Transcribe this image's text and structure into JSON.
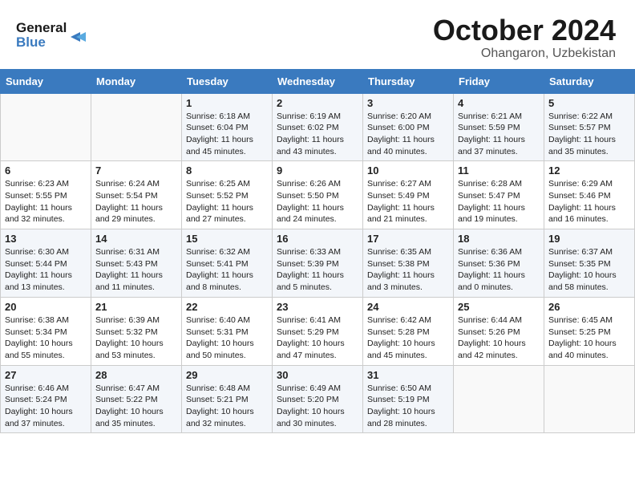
{
  "logo": {
    "line1": "General",
    "line2": "Blue"
  },
  "title": "October 2024",
  "location": "Ohangaron, Uzbekistan",
  "weekdays": [
    "Sunday",
    "Monday",
    "Tuesday",
    "Wednesday",
    "Thursday",
    "Friday",
    "Saturday"
  ],
  "weeks": [
    [
      {
        "day": "",
        "sunrise": "",
        "sunset": "",
        "daylight": ""
      },
      {
        "day": "",
        "sunrise": "",
        "sunset": "",
        "daylight": ""
      },
      {
        "day": "1",
        "sunrise": "Sunrise: 6:18 AM",
        "sunset": "Sunset: 6:04 PM",
        "daylight": "Daylight: 11 hours and 45 minutes."
      },
      {
        "day": "2",
        "sunrise": "Sunrise: 6:19 AM",
        "sunset": "Sunset: 6:02 PM",
        "daylight": "Daylight: 11 hours and 43 minutes."
      },
      {
        "day": "3",
        "sunrise": "Sunrise: 6:20 AM",
        "sunset": "Sunset: 6:00 PM",
        "daylight": "Daylight: 11 hours and 40 minutes."
      },
      {
        "day": "4",
        "sunrise": "Sunrise: 6:21 AM",
        "sunset": "Sunset: 5:59 PM",
        "daylight": "Daylight: 11 hours and 37 minutes."
      },
      {
        "day": "5",
        "sunrise": "Sunrise: 6:22 AM",
        "sunset": "Sunset: 5:57 PM",
        "daylight": "Daylight: 11 hours and 35 minutes."
      }
    ],
    [
      {
        "day": "6",
        "sunrise": "Sunrise: 6:23 AM",
        "sunset": "Sunset: 5:55 PM",
        "daylight": "Daylight: 11 hours and 32 minutes."
      },
      {
        "day": "7",
        "sunrise": "Sunrise: 6:24 AM",
        "sunset": "Sunset: 5:54 PM",
        "daylight": "Daylight: 11 hours and 29 minutes."
      },
      {
        "day": "8",
        "sunrise": "Sunrise: 6:25 AM",
        "sunset": "Sunset: 5:52 PM",
        "daylight": "Daylight: 11 hours and 27 minutes."
      },
      {
        "day": "9",
        "sunrise": "Sunrise: 6:26 AM",
        "sunset": "Sunset: 5:50 PM",
        "daylight": "Daylight: 11 hours and 24 minutes."
      },
      {
        "day": "10",
        "sunrise": "Sunrise: 6:27 AM",
        "sunset": "Sunset: 5:49 PM",
        "daylight": "Daylight: 11 hours and 21 minutes."
      },
      {
        "day": "11",
        "sunrise": "Sunrise: 6:28 AM",
        "sunset": "Sunset: 5:47 PM",
        "daylight": "Daylight: 11 hours and 19 minutes."
      },
      {
        "day": "12",
        "sunrise": "Sunrise: 6:29 AM",
        "sunset": "Sunset: 5:46 PM",
        "daylight": "Daylight: 11 hours and 16 minutes."
      }
    ],
    [
      {
        "day": "13",
        "sunrise": "Sunrise: 6:30 AM",
        "sunset": "Sunset: 5:44 PM",
        "daylight": "Daylight: 11 hours and 13 minutes."
      },
      {
        "day": "14",
        "sunrise": "Sunrise: 6:31 AM",
        "sunset": "Sunset: 5:43 PM",
        "daylight": "Daylight: 11 hours and 11 minutes."
      },
      {
        "day": "15",
        "sunrise": "Sunrise: 6:32 AM",
        "sunset": "Sunset: 5:41 PM",
        "daylight": "Daylight: 11 hours and 8 minutes."
      },
      {
        "day": "16",
        "sunrise": "Sunrise: 6:33 AM",
        "sunset": "Sunset: 5:39 PM",
        "daylight": "Daylight: 11 hours and 5 minutes."
      },
      {
        "day": "17",
        "sunrise": "Sunrise: 6:35 AM",
        "sunset": "Sunset: 5:38 PM",
        "daylight": "Daylight: 11 hours and 3 minutes."
      },
      {
        "day": "18",
        "sunrise": "Sunrise: 6:36 AM",
        "sunset": "Sunset: 5:36 PM",
        "daylight": "Daylight: 11 hours and 0 minutes."
      },
      {
        "day": "19",
        "sunrise": "Sunrise: 6:37 AM",
        "sunset": "Sunset: 5:35 PM",
        "daylight": "Daylight: 10 hours and 58 minutes."
      }
    ],
    [
      {
        "day": "20",
        "sunrise": "Sunrise: 6:38 AM",
        "sunset": "Sunset: 5:34 PM",
        "daylight": "Daylight: 10 hours and 55 minutes."
      },
      {
        "day": "21",
        "sunrise": "Sunrise: 6:39 AM",
        "sunset": "Sunset: 5:32 PM",
        "daylight": "Daylight: 10 hours and 53 minutes."
      },
      {
        "day": "22",
        "sunrise": "Sunrise: 6:40 AM",
        "sunset": "Sunset: 5:31 PM",
        "daylight": "Daylight: 10 hours and 50 minutes."
      },
      {
        "day": "23",
        "sunrise": "Sunrise: 6:41 AM",
        "sunset": "Sunset: 5:29 PM",
        "daylight": "Daylight: 10 hours and 47 minutes."
      },
      {
        "day": "24",
        "sunrise": "Sunrise: 6:42 AM",
        "sunset": "Sunset: 5:28 PM",
        "daylight": "Daylight: 10 hours and 45 minutes."
      },
      {
        "day": "25",
        "sunrise": "Sunrise: 6:44 AM",
        "sunset": "Sunset: 5:26 PM",
        "daylight": "Daylight: 10 hours and 42 minutes."
      },
      {
        "day": "26",
        "sunrise": "Sunrise: 6:45 AM",
        "sunset": "Sunset: 5:25 PM",
        "daylight": "Daylight: 10 hours and 40 minutes."
      }
    ],
    [
      {
        "day": "27",
        "sunrise": "Sunrise: 6:46 AM",
        "sunset": "Sunset: 5:24 PM",
        "daylight": "Daylight: 10 hours and 37 minutes."
      },
      {
        "day": "28",
        "sunrise": "Sunrise: 6:47 AM",
        "sunset": "Sunset: 5:22 PM",
        "daylight": "Daylight: 10 hours and 35 minutes."
      },
      {
        "day": "29",
        "sunrise": "Sunrise: 6:48 AM",
        "sunset": "Sunset: 5:21 PM",
        "daylight": "Daylight: 10 hours and 32 minutes."
      },
      {
        "day": "30",
        "sunrise": "Sunrise: 6:49 AM",
        "sunset": "Sunset: 5:20 PM",
        "daylight": "Daylight: 10 hours and 30 minutes."
      },
      {
        "day": "31",
        "sunrise": "Sunrise: 6:50 AM",
        "sunset": "Sunset: 5:19 PM",
        "daylight": "Daylight: 10 hours and 28 minutes."
      },
      {
        "day": "",
        "sunrise": "",
        "sunset": "",
        "daylight": ""
      },
      {
        "day": "",
        "sunrise": "",
        "sunset": "",
        "daylight": ""
      }
    ]
  ]
}
